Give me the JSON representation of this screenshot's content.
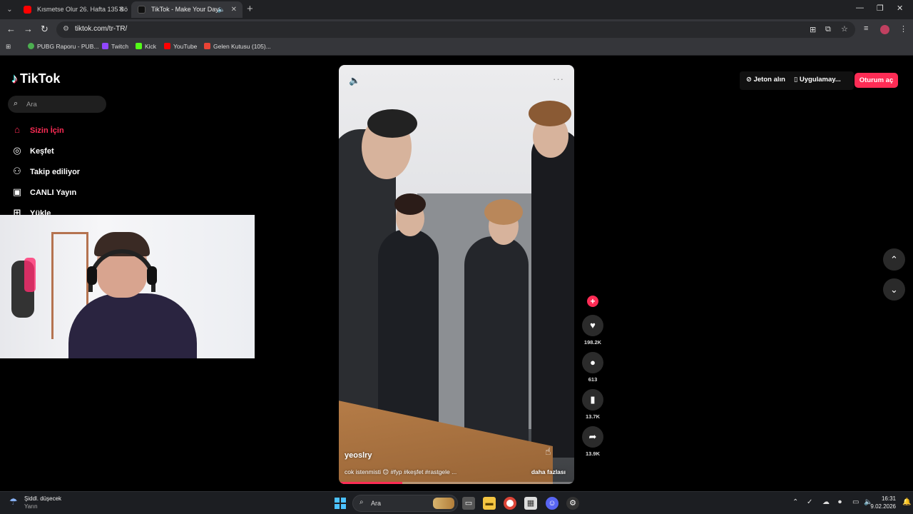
{
  "browser": {
    "tabs": [
      {
        "label": "Kısmetse Olur 26. Hafta 135 Bö",
        "favicon_color": "#ff0000",
        "active": false
      },
      {
        "label": "TikTok - Make Your Day",
        "favicon_color": "#111111",
        "active": true
      }
    ],
    "url": "tiktok.com/tr-TR/",
    "bookmarks": [
      {
        "label": "PUBG Raporu - PUB...",
        "color": "#4caf50"
      },
      {
        "label": "Twitch",
        "color": "#9146ff"
      },
      {
        "label": "Kick",
        "color": "#53fc18"
      },
      {
        "label": "YouTube",
        "color": "#ff0000"
      },
      {
        "label": "Gelen Kutusu (105)...",
        "color": "#ea4335"
      }
    ]
  },
  "tiktok": {
    "logo": "TikTok",
    "search_placeholder": "Ara",
    "nav": [
      {
        "label": "Sizin İçin",
        "icon": "home-icon",
        "active": true
      },
      {
        "label": "Keşfet",
        "icon": "compass-icon",
        "active": false
      },
      {
        "label": "Takip ediliyor",
        "icon": "following-icon",
        "active": false
      },
      {
        "label": "CANLI Yayın",
        "icon": "live-icon",
        "active": false
      },
      {
        "label": "Yükle",
        "icon": "upload-icon",
        "active": false
      }
    ],
    "header": {
      "coins": "Jeton alın",
      "app": "Uygulamay...",
      "login": "Oturum aç"
    },
    "video": {
      "author": "yeoslry",
      "caption": "cok istenmisti 😊 #fyp #keşfet #rastgele ...",
      "more": "daha fazlası",
      "progress": 0.27
    },
    "actions": {
      "likes": "198.2K",
      "comments": "613",
      "saves": "13.7K",
      "shares": "13.9K"
    }
  },
  "taskbar": {
    "weather_line1": "Şiddl. düşecek",
    "weather_line2": "Yarın",
    "search_label": "Ara",
    "time": "16:31",
    "date": "9.02.2026"
  }
}
